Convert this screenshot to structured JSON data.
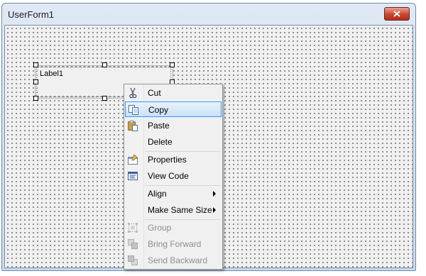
{
  "window": {
    "title": "UserForm1"
  },
  "form": {
    "label_control": {
      "caption": "Label1"
    }
  },
  "context_menu": {
    "items": [
      {
        "label": "Cut",
        "icon": "scissors-icon",
        "enabled": true
      },
      {
        "label": "Copy",
        "icon": "copy-icon",
        "enabled": true,
        "highlighted": true
      },
      {
        "label": "Paste",
        "icon": "paste-icon",
        "enabled": true
      },
      {
        "label": "Delete",
        "icon": "",
        "enabled": true
      },
      {
        "label": "Properties",
        "icon": "properties-icon",
        "enabled": true
      },
      {
        "label": "View Code",
        "icon": "code-window-icon",
        "enabled": true
      },
      {
        "label": "Align",
        "icon": "",
        "enabled": true,
        "submenu": true
      },
      {
        "label": "Make Same Size",
        "icon": "",
        "enabled": true,
        "submenu": true
      },
      {
        "label": "Group",
        "icon": "group-icon",
        "enabled": false
      },
      {
        "label": "Bring Forward",
        "icon": "bring-forward-icon",
        "enabled": false
      },
      {
        "label": "Send Backward",
        "icon": "send-backward-icon",
        "enabled": false
      }
    ]
  },
  "colors": {
    "highlight_border": "#3399ff",
    "close_button": "#c9452b",
    "disabled_text": "#8d8d8d"
  }
}
